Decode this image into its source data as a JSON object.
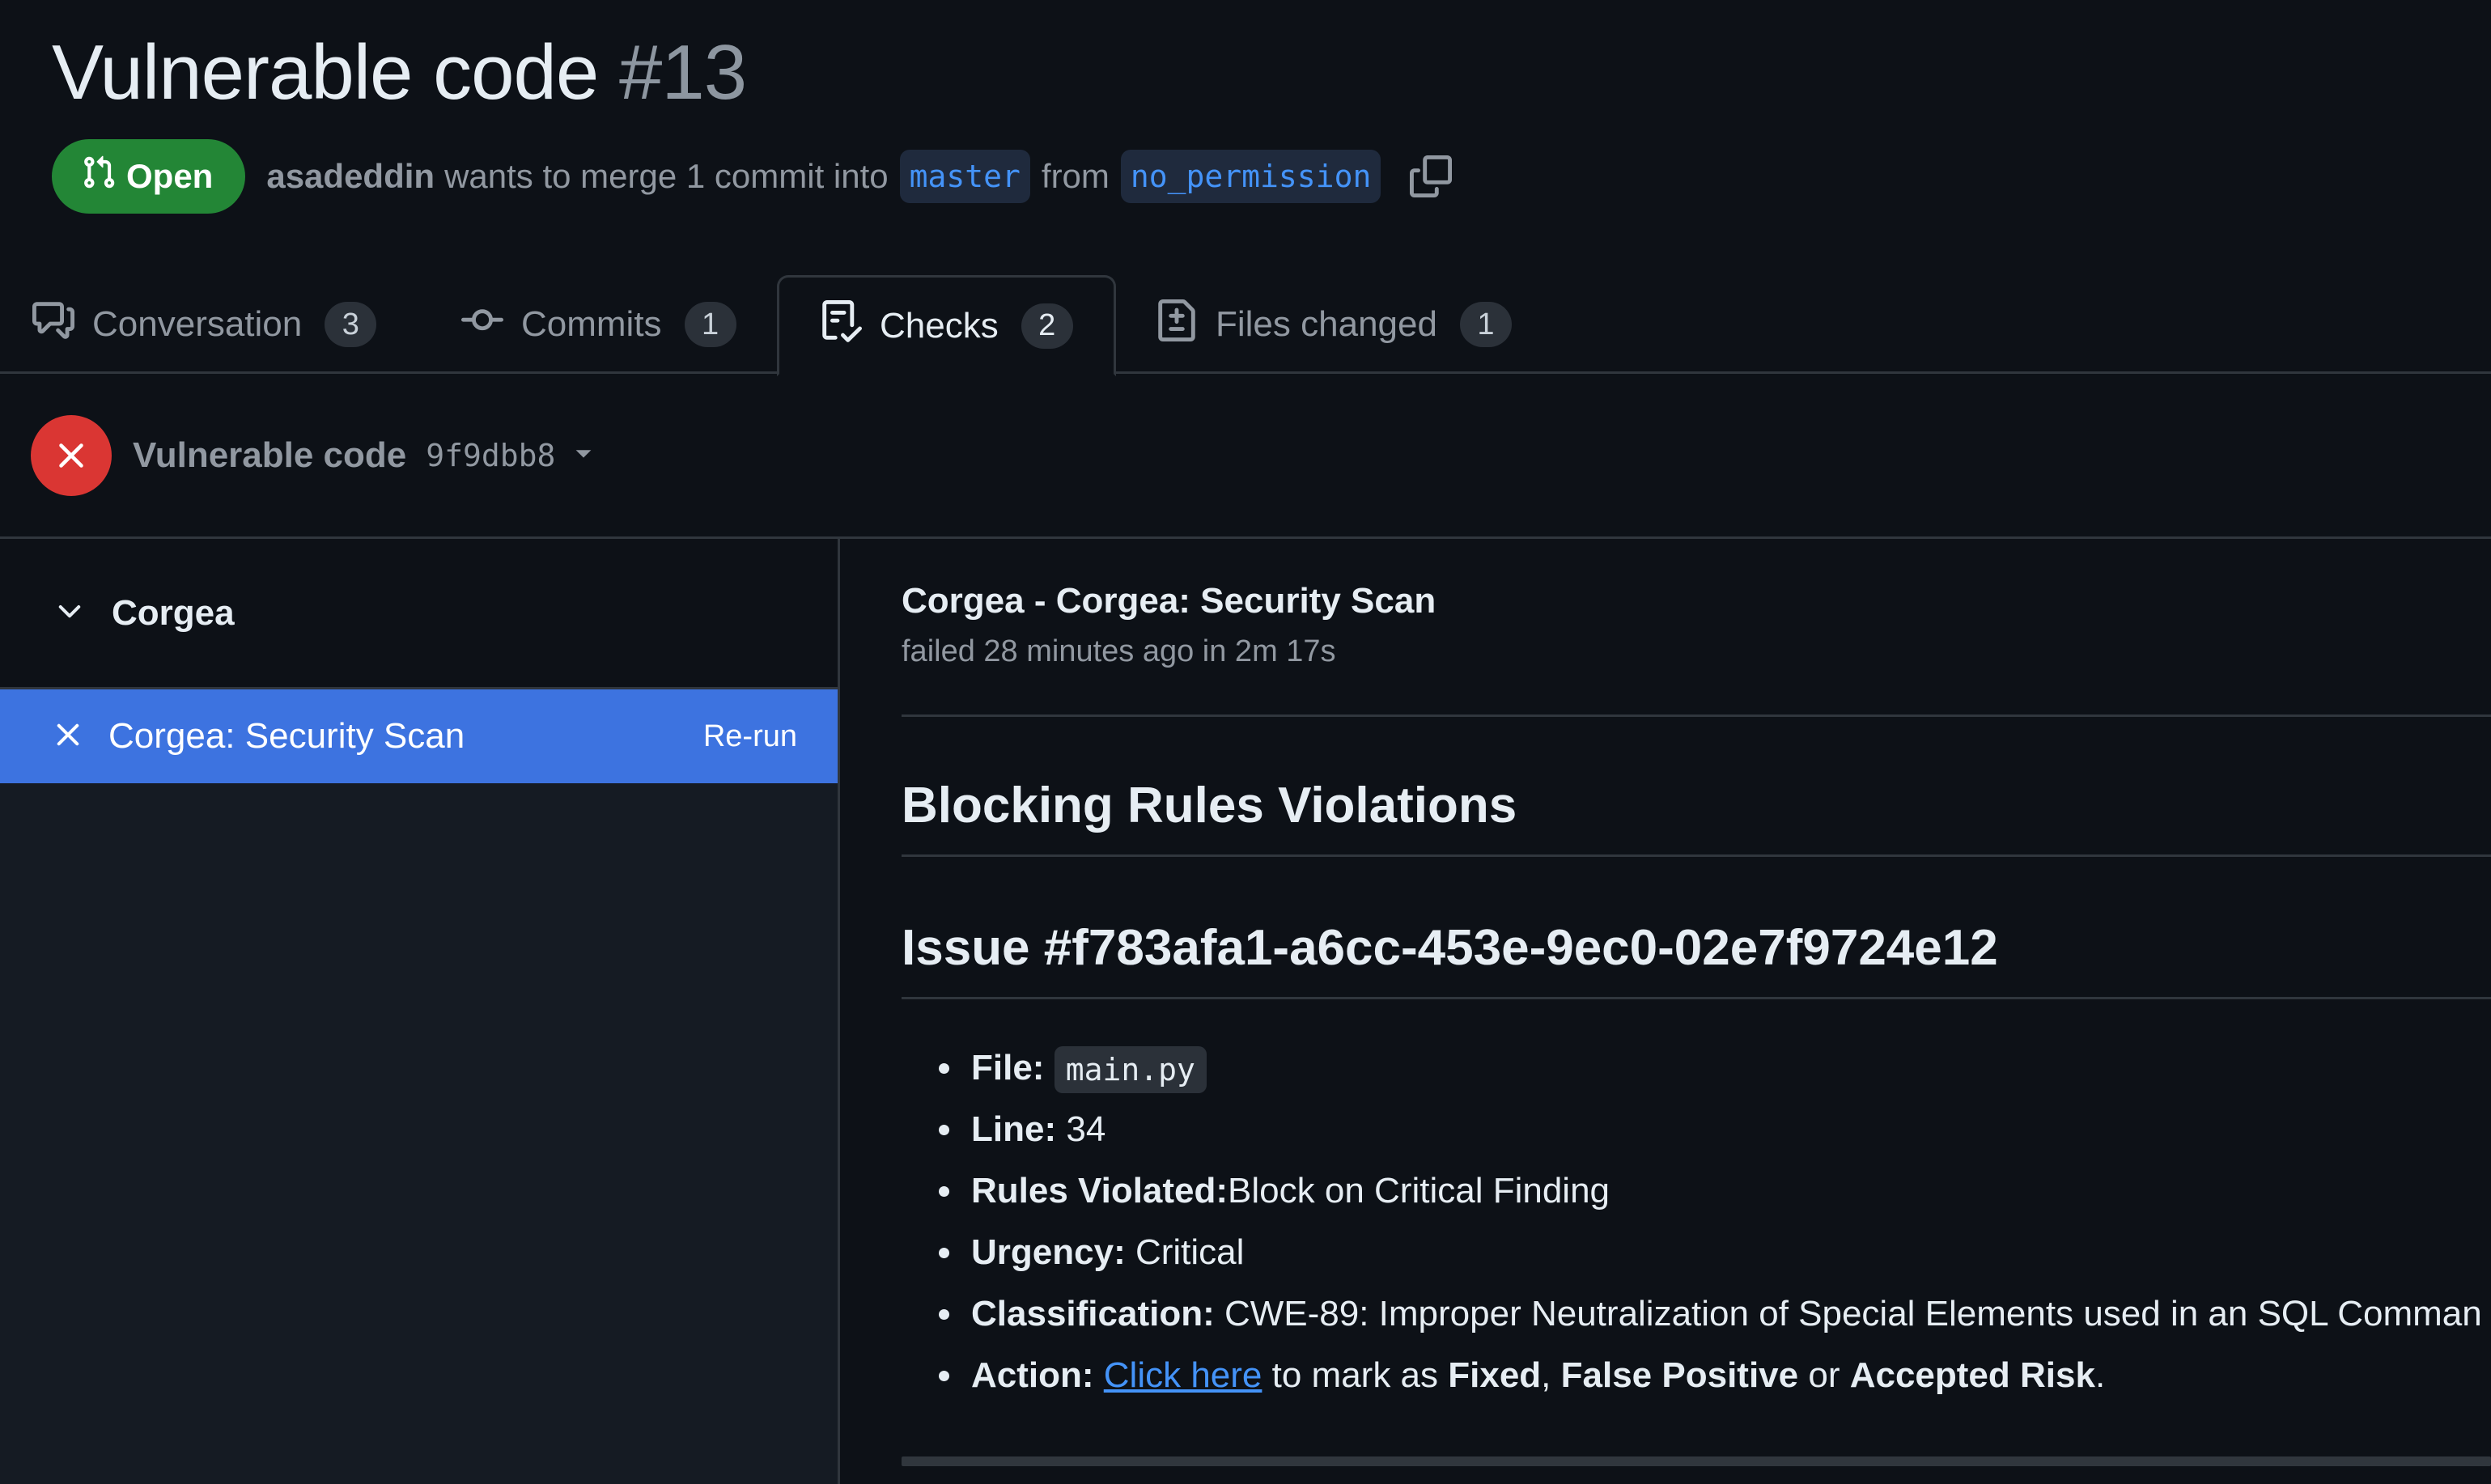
{
  "pr": {
    "title": "Vulnerable code",
    "number": "#13",
    "state": "Open",
    "author": "asadeddin",
    "merge_text": "wants to merge 1 commit into",
    "base_branch": "master",
    "from_text": "from",
    "head_branch": "no_permission"
  },
  "tabs": [
    {
      "label": "Conversation",
      "count": "3",
      "icon": "comment-discussion-icon"
    },
    {
      "label": "Commits",
      "count": "1",
      "icon": "git-commit-icon"
    },
    {
      "label": "Checks",
      "count": "2",
      "icon": "checklist-icon",
      "selected": true
    },
    {
      "label": "Files changed",
      "count": "1",
      "icon": "file-diff-icon"
    }
  ],
  "check": {
    "title": "Vulnerable code",
    "sha": "9f9dbb8",
    "status_color": "#da3633"
  },
  "sidebar": {
    "suite": "Corgea",
    "run": "Corgea: Security Scan",
    "rerun": "Re-run",
    "selected_color": "#3d73e0"
  },
  "run": {
    "full_title": "Corgea - Corgea: Security Scan",
    "status": "failed 28 minutes ago in 2m 17s"
  },
  "report": {
    "heading": "Blocking Rules Violations",
    "issue_title": "Issue #f783afa1-a6cc-453e-9ec0-02e7f9724e12",
    "file_label": "File:",
    "file_value": "main.py",
    "line_label": "Line:",
    "line_value": "34",
    "rules_label": "Rules Violated:",
    "rules_value": "Block on Critical Finding",
    "urgency_label": "Urgency:",
    "urgency_value": "Critical",
    "classification_label": "Classification:",
    "classification_value": "CWE-89: Improper Neutralization of Special Elements used in an SQL Comman",
    "action_label": "Action:",
    "action_link": "Click here",
    "action_mid": "to mark as",
    "action_fixed": "Fixed",
    "action_sep": ",",
    "action_fp": "False Positive",
    "action_or": "or",
    "action_ar": "Accepted Risk",
    "action_end": "."
  },
  "colors": {
    "background": "#0d1117",
    "open_badge": "#238636",
    "link": "#4493f8"
  }
}
